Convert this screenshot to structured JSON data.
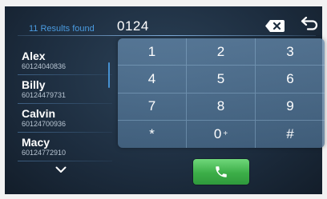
{
  "header": {
    "results_label": "11 Results found",
    "dialed_number": "0124"
  },
  "contacts": [
    {
      "name": "Alex",
      "number": "60124040836"
    },
    {
      "name": "Billy",
      "number": "60124479731"
    },
    {
      "name": "Calvin",
      "number": "60124700936"
    },
    {
      "name": "Macy",
      "number": "60124772910"
    }
  ],
  "keypad": {
    "keys": [
      {
        "label": "1",
        "sub": ""
      },
      {
        "label": "2",
        "sub": ""
      },
      {
        "label": "3",
        "sub": ""
      },
      {
        "label": "4",
        "sub": ""
      },
      {
        "label": "5",
        "sub": ""
      },
      {
        "label": "6",
        "sub": ""
      },
      {
        "label": "7",
        "sub": ""
      },
      {
        "label": "8",
        "sub": ""
      },
      {
        "label": "9",
        "sub": ""
      },
      {
        "label": "*",
        "sub": ""
      },
      {
        "label": "0",
        "sub": "+"
      },
      {
        "label": "#",
        "sub": ""
      }
    ]
  },
  "icons": {
    "backspace": "backspace-icon",
    "back": "back-arrow-icon",
    "scroll_down": "chevron-down-icon",
    "call": "phone-icon"
  },
  "colors": {
    "accent_blue": "#4a9be0",
    "call_green": "#3cae48",
    "text_white": "#ffffff"
  }
}
